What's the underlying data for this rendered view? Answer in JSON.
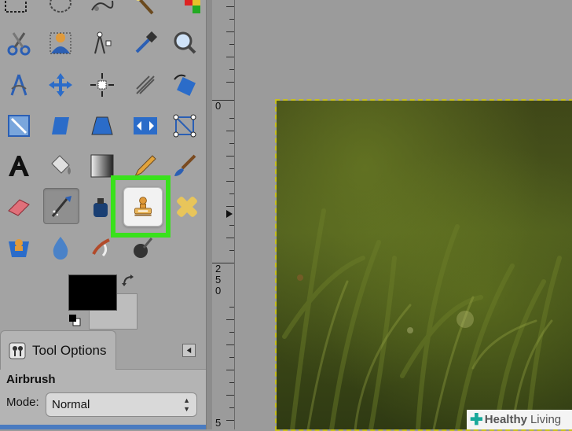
{
  "colors": {
    "highlight": "#39e11c",
    "foreground": "#000000",
    "background": "#bdbdbd"
  },
  "toolbox": {
    "tools": [
      {
        "name": "rect-select-icon"
      },
      {
        "name": "ellipse-select-icon"
      },
      {
        "name": "free-select-icon"
      },
      {
        "name": "fuzzy-select-icon"
      },
      {
        "name": "by-color-select-icon"
      },
      {
        "name": "scissors-select-icon"
      },
      {
        "name": "foreground-select-icon"
      },
      {
        "name": "paths-icon"
      },
      {
        "name": "color-picker-icon"
      },
      {
        "name": "zoom-icon"
      },
      {
        "name": "measure-icon"
      },
      {
        "name": "move-icon"
      },
      {
        "name": "align-icon"
      },
      {
        "name": "crop-icon"
      },
      {
        "name": "rotate-icon"
      },
      {
        "name": "scale-icon"
      },
      {
        "name": "shear-icon"
      },
      {
        "name": "perspective-icon"
      },
      {
        "name": "flip-icon"
      },
      {
        "name": "cage-icon"
      },
      {
        "name": "text-icon"
      },
      {
        "name": "bucket-fill-icon"
      },
      {
        "name": "blend-icon"
      },
      {
        "name": "pencil-icon"
      },
      {
        "name": "paintbrush-icon"
      },
      {
        "name": "eraser-icon"
      },
      {
        "name": "airbrush-icon"
      },
      {
        "name": "ink-icon"
      },
      {
        "name": "clone-icon"
      },
      {
        "name": "heal-icon"
      },
      {
        "name": "perspective-clone-icon"
      },
      {
        "name": "blur-icon"
      },
      {
        "name": "smudge-icon"
      },
      {
        "name": "dodge-burn-icon"
      }
    ]
  },
  "tool_options": {
    "tab_label": "Tool Options",
    "tool_name": "Airbrush",
    "mode_label": "Mode:",
    "mode_value": "Normal"
  },
  "ruler": {
    "labels": [
      "0",
      "2",
      "5",
      "0",
      "5"
    ]
  },
  "watermark": {
    "plus": "✚",
    "brand_bold": "Healthy",
    "brand_rest": "Living"
  }
}
